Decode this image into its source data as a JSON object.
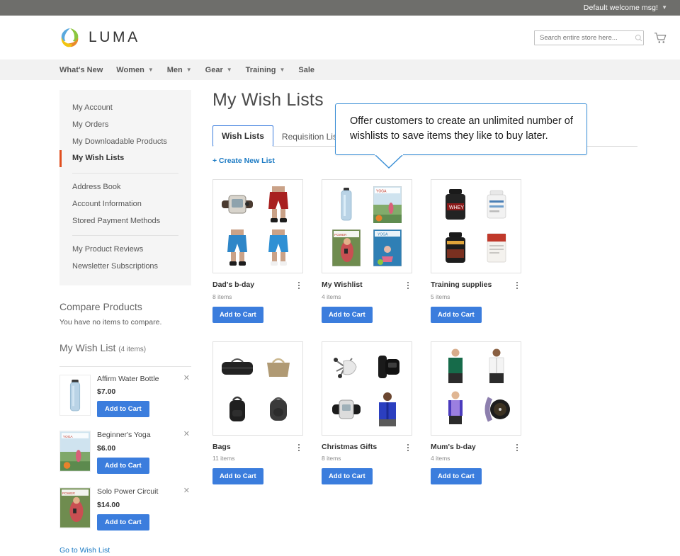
{
  "topbar": {
    "welcome": "Default welcome msg!",
    "caret_icon": "chevron-down-icon"
  },
  "header": {
    "logo_text": "LUMA",
    "logo_icon": "luma-logo-icon",
    "search": {
      "placeholder": "Search entire store here...",
      "value": "",
      "icon": "search-icon"
    },
    "cart_icon": "shopping-cart-icon"
  },
  "mainnav": {
    "items": [
      {
        "label": "What's New",
        "has_chevron": false
      },
      {
        "label": "Women",
        "has_chevron": true
      },
      {
        "label": "Men",
        "has_chevron": true
      },
      {
        "label": "Gear",
        "has_chevron": true
      },
      {
        "label": "Training",
        "has_chevron": true
      },
      {
        "label": "Sale",
        "has_chevron": false
      }
    ],
    "chevron_icon": "chevron-down-icon"
  },
  "sidebar": {
    "account_nav": [
      {
        "label": "My Account",
        "active": false
      },
      {
        "label": "My Orders",
        "active": false
      },
      {
        "label": "My Downloadable Products",
        "active": false
      },
      {
        "label": "My Wish Lists",
        "active": true
      },
      {
        "label": "Address Book",
        "active": false
      },
      {
        "label": "Account Information",
        "active": false
      },
      {
        "label": "Stored Payment Methods",
        "active": false
      },
      {
        "label": "My Product Reviews",
        "active": false
      },
      {
        "label": "Newsletter Subscriptions",
        "active": false
      }
    ],
    "compare": {
      "title": "Compare Products",
      "empty_text": "You have no items to compare."
    },
    "wishlist": {
      "title": "My Wish List",
      "count_text": "(4 items)",
      "items": [
        {
          "name": "Affirm Water Bottle",
          "price": "$7.00",
          "button": "Add to Cart",
          "thumb": "water-bottle",
          "remove_icon": "close-icon"
        },
        {
          "name": "Beginner's Yoga",
          "price": "$6.00",
          "button": "Add to Cart",
          "thumb": "yoga-dvd",
          "remove_icon": "close-icon"
        },
        {
          "name": "Solo Power Circuit",
          "price": "$14.00",
          "button": "Add to Cart",
          "thumb": "power-dvd",
          "remove_icon": "close-icon"
        }
      ],
      "go_link": "Go to Wish List"
    }
  },
  "main": {
    "title": "My Wish Lists",
    "tabs": [
      {
        "label": "Wish Lists",
        "active": true
      },
      {
        "label": "Requisition Lists",
        "active": false
      }
    ],
    "create_link": "+ Create New List",
    "cards": [
      {
        "title": "Dad's b-day",
        "count": "8 items",
        "button": "Add to Cart",
        "menu_icon": "more-vertical-icon",
        "thumbs": [
          "watch-brown",
          "shorts-red",
          "shorts-blue",
          "shorts-blue2"
        ]
      },
      {
        "title": "My Wishlist",
        "count": "4 items",
        "button": "Add to Cart",
        "menu_icon": "more-vertical-icon",
        "thumbs": [
          "water-bottle",
          "yoga-dvd",
          "power-dvd",
          "yoga-blue-dvd"
        ]
      },
      {
        "title": "Training supplies",
        "count": "5 items",
        "button": "Add to Cart",
        "menu_icon": "more-vertical-icon",
        "thumbs": [
          "whey-tub",
          "white-tub",
          "protein-tub",
          "red-pouch"
        ]
      },
      {
        "title": "Bags",
        "count": "11 items",
        "button": "Add to Cart",
        "menu_icon": "more-vertical-icon",
        "thumbs": [
          "duffel-black",
          "tote-tan",
          "backpack-black",
          "backpack-gray"
        ]
      },
      {
        "title": "Christmas Gifts",
        "count": "8 items",
        "button": "Add to Cart",
        "menu_icon": "more-vertical-icon",
        "thumbs": [
          "accessory-silver",
          "watch-black",
          "watch-silver",
          "hoodie-blue"
        ]
      },
      {
        "title": "Mum's b-day",
        "count": "4 items",
        "button": "Add to Cart",
        "menu_icon": "more-vertical-icon",
        "thumbs": [
          "top-green",
          "hoodie-white",
          "top-purple",
          "watch-sport"
        ]
      }
    ]
  },
  "callout": {
    "text": "Offer customers to create an unlimited number of wishlists to save items they like to buy later.",
    "border_color": "#3b8fd6"
  },
  "colors": {
    "accent_blue": "#3b7ddd",
    "link_blue": "#1979c3",
    "topbar_gray": "#6e6e6b",
    "nav_gray": "#f2f2f2",
    "active_orange": "#e04e1e"
  }
}
